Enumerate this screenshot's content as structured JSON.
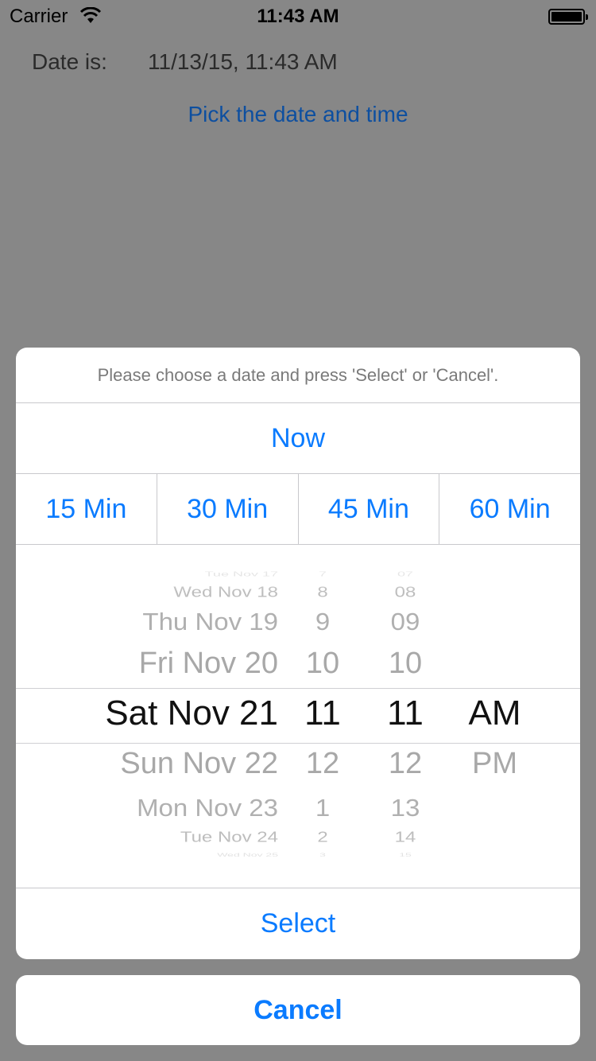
{
  "status_bar": {
    "carrier": "Carrier",
    "time": "11:43 AM",
    "wifi_icon": "wifi-icon",
    "battery_icon": "battery-icon"
  },
  "content": {
    "date_label": "Date is:",
    "date_value": "11/13/15, 11:43 AM",
    "pick_link": "Pick the date and time"
  },
  "sheet": {
    "message": "Please choose a date and press 'Select' or 'Cancel'.",
    "now_label": "Now",
    "quick_buttons": [
      "15 Min",
      "30 Min",
      "45 Min",
      "60 Min"
    ],
    "select_label": "Select",
    "cancel_label": "Cancel"
  },
  "picker": {
    "dates": [
      "Tue Nov 17",
      "Wed Nov 18",
      "Thu Nov 19",
      "Fri Nov 20",
      "Sat Nov 21",
      "Sun Nov 22",
      "Mon Nov 23",
      "Tue Nov 24",
      "Wed Nov 25"
    ],
    "hours": [
      "7",
      "8",
      "9",
      "10",
      "11",
      "12",
      "1",
      "2",
      "3"
    ],
    "minutes": [
      "07",
      "08",
      "09",
      "10",
      "11",
      "12",
      "13",
      "14",
      "15"
    ],
    "ampm": [
      "",
      "",
      "",
      "",
      "AM",
      "PM",
      "",
      "",
      ""
    ],
    "selected_index": 4
  },
  "colors": {
    "accent": "#0a7bff",
    "dim_background": "#878787",
    "link": "#0d4fa0"
  }
}
